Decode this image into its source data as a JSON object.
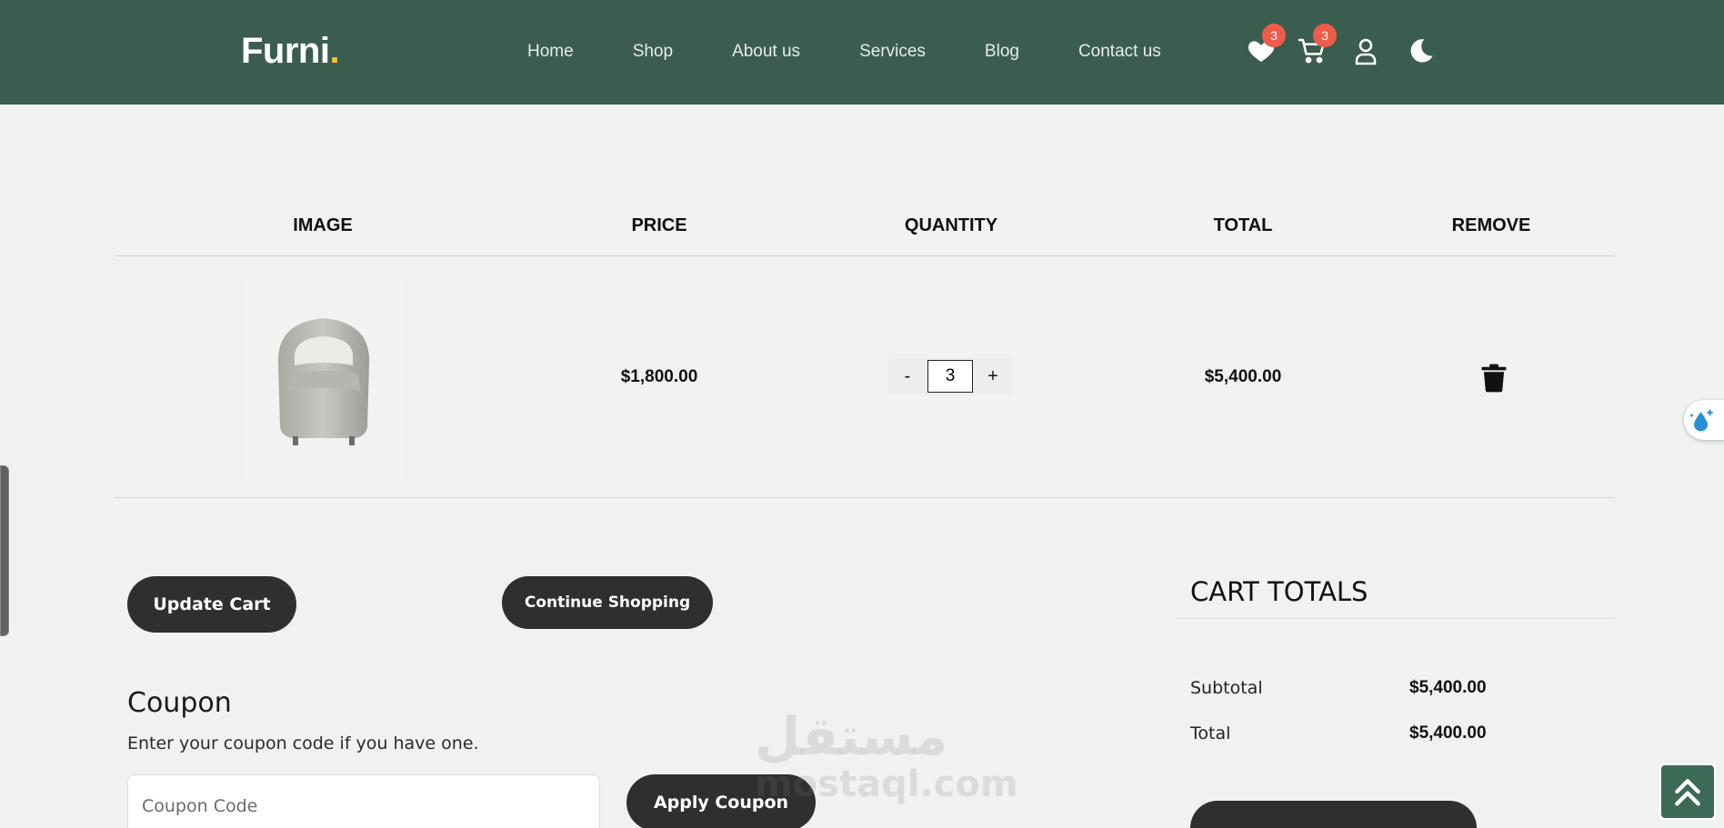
{
  "header": {
    "logo_text": "Furni",
    "logo_dot": ".",
    "nav": [
      "Home",
      "Shop",
      "About us",
      "Services",
      "Blog",
      "Contact us"
    ],
    "wishlist_count": "3",
    "cart_count": "3",
    "icons": [
      "heart-icon",
      "cart-icon",
      "user-icon",
      "moon-icon"
    ]
  },
  "table": {
    "headers": [
      "IMAGE",
      "PRICE",
      "QUANTITY",
      "TOTAL",
      "REMOVE"
    ],
    "rows": [
      {
        "image": "armchair",
        "price": "$1,800.00",
        "qty_minus": "-",
        "quantity": "3",
        "qty_plus": "+",
        "total": "$5,400.00"
      }
    ]
  },
  "actions": {
    "update_cart": "Update Cart",
    "continue_shopping": "Continue Shopping"
  },
  "coupon": {
    "title": "Coupon",
    "description": "Enter your coupon code if you have one.",
    "placeholder": "Coupon Code",
    "apply": "Apply Coupon"
  },
  "totals": {
    "title": "CART TOTALS",
    "subtotal_label": "Subtotal",
    "subtotal_value": "$5,400.00",
    "total_label": "Total",
    "total_value": "$5,400.00"
  },
  "watermark": {
    "arabic": "مستقل",
    "latin": "mostaql.com"
  },
  "colors": {
    "header_bg": "#3b5d50",
    "page_bg": "#eff2f1",
    "button_bg": "#2f2f2f",
    "badge": "#ef5b49",
    "logo_dot": "#f9bf29"
  }
}
